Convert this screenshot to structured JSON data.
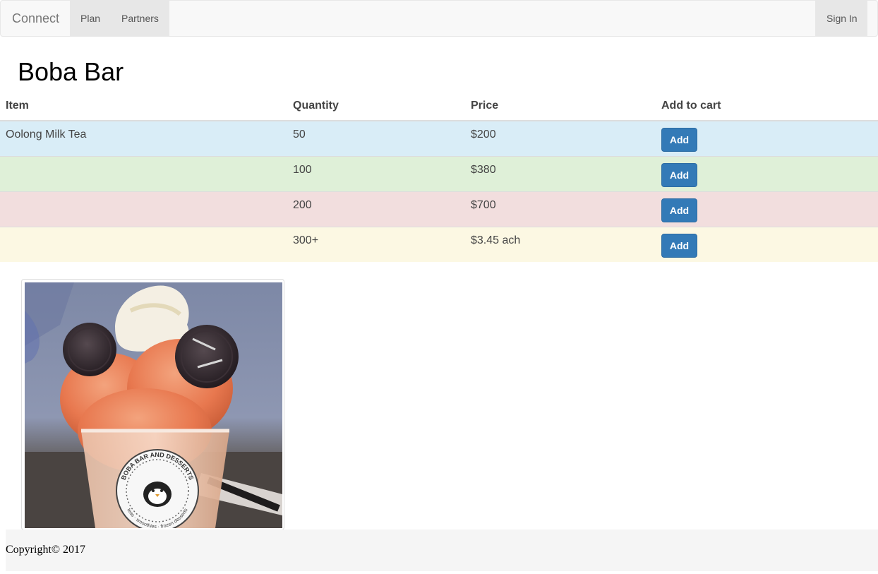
{
  "navbar": {
    "brand": "Connect",
    "links": [
      "Plan",
      "Partners"
    ],
    "right_link": "Sign In"
  },
  "page": {
    "title": "Boba Bar"
  },
  "table": {
    "headers": [
      "Item",
      "Quantity",
      "Price",
      "Add to cart"
    ],
    "rows": [
      {
        "item": "Oolong Milk Tea",
        "quantity": "50",
        "price": "$200",
        "button": "Add"
      },
      {
        "item": "",
        "quantity": "100",
        "price": "$380",
        "button": "Add"
      },
      {
        "item": "",
        "quantity": "200",
        "price": "$700",
        "button": "Add"
      },
      {
        "item": "",
        "quantity": "300+",
        "price": "$3.45 ach",
        "button": "Add"
      }
    ]
  },
  "image": {
    "cup_label_top": "BOBA BAR AND DESSERTS",
    "cup_label_bottom": "teas · smoothies · frozen desserts"
  },
  "footer": {
    "copyright": "Copyright© 2017"
  },
  "colors": {
    "primary": "#337ab7",
    "row_info": "#d9edf7",
    "row_success": "#dff0d8",
    "row_danger": "#f2dede",
    "row_warning": "#fcf8e3"
  }
}
